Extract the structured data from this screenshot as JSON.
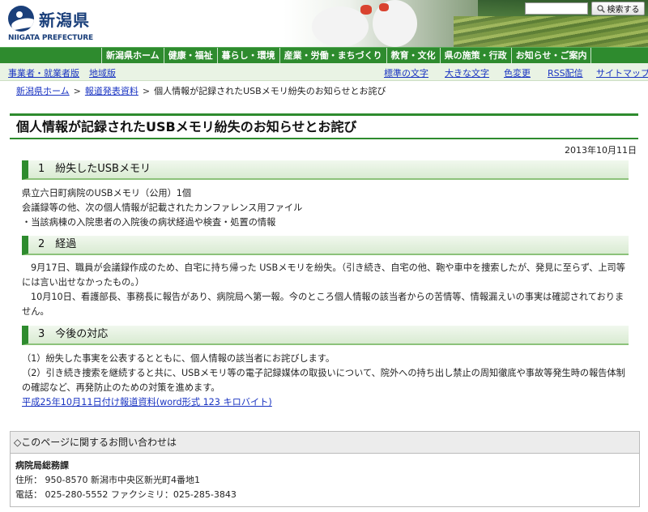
{
  "header": {
    "logo_jp": "新潟県",
    "logo_en": "NIIGATA PREFECTURE",
    "search_button": "検索する",
    "search_placeholder": ""
  },
  "main_nav": [
    "新潟県ホーム",
    "健康・福祉",
    "暮らし・環境",
    "産業・労働・まちづくり",
    "教育・文化",
    "県の施策・行政",
    "お知らせ・ご案内"
  ],
  "sub_nav": {
    "left": [
      "事業者・就業者版",
      "地域版"
    ],
    "right": [
      "標準の文字",
      "大きな文字",
      "色変更",
      "RSS配信",
      "サイトマップ"
    ]
  },
  "breadcrumb": {
    "items": [
      "新潟県ホーム",
      "報道発表資料"
    ],
    "current": "個人情報が記録されたUSBメモリ紛失のお知らせとお詫び",
    "separator": ">"
  },
  "page": {
    "title": "個人情報が記録されたUSBメモリ紛失のお知らせとお詫び",
    "date": "2013年10月11日"
  },
  "sections": [
    {
      "heading": "1　紛失したUSBメモリ",
      "lines": [
        "県立六日町病院のUSBメモリ（公用）1個",
        "会議録等の他、次の個人情報が記載されたカンファレンス用ファイル",
        "・当該病棟の入院患者の入院後の病状経過や検査・処置の情報"
      ]
    },
    {
      "heading": "2　経過",
      "lines": [
        "9月17日、職員が会議録作成のため、自宅に持ち帰った USBメモリを紛失。（引き続き、自宅の他、鞄や車中を捜索したが、発見に至らず、上司等には言い出せなかったもの。）",
        "10月10日、看護部長、事務長に報告があり、病院局へ第一報。今のところ個人情報の該当者からの苦情等、情報漏えいの事実は確認されておりません。"
      ]
    },
    {
      "heading": "3　今後の対応",
      "lines": [
        "（1）紛失した事実を公表するとともに、個人情報の該当者にお詫びします。",
        "（2）引き続き捜索を継続すると共に、USBメモリ等の電子記録媒体の取扱いについて、院外への持ち出し禁止の周知徹底や事故等発生時の報告体制の確認など、再発防止のための対策を進めます。"
      ],
      "link": "平成25年10月11日付け報道資料(word形式  123 キロバイト)"
    }
  ],
  "contact": {
    "heading": "◇このページに関するお問い合わせは",
    "department": "病院局総務課",
    "address": "住所：  950-8570  新潟市中央区新光町4番地1",
    "phone": "電話：  025-280-5552   ファクシミリ：025-285-3843"
  },
  "colors": {
    "nav_green": "#2e8b2e",
    "link_blue": "#1a34c2",
    "subnav_bg": "#e9f3e4"
  }
}
